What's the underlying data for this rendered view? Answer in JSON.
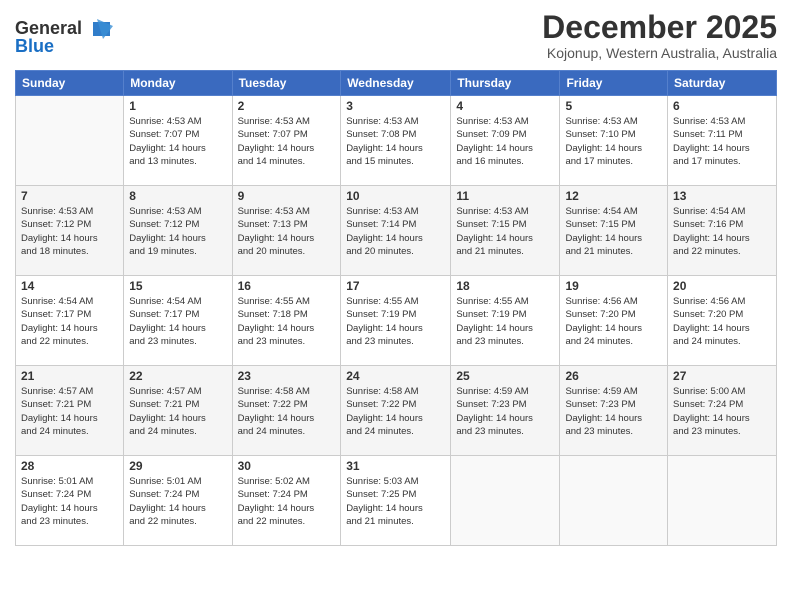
{
  "logo": {
    "line1": "General",
    "line2": "Blue"
  },
  "title": "December 2025",
  "location": "Kojonup, Western Australia, Australia",
  "weekdays": [
    "Sunday",
    "Monday",
    "Tuesday",
    "Wednesday",
    "Thursday",
    "Friday",
    "Saturday"
  ],
  "weeks": [
    [
      {
        "day": "",
        "info": ""
      },
      {
        "day": "1",
        "info": "Sunrise: 4:53 AM\nSunset: 7:07 PM\nDaylight: 14 hours\nand 13 minutes."
      },
      {
        "day": "2",
        "info": "Sunrise: 4:53 AM\nSunset: 7:07 PM\nDaylight: 14 hours\nand 14 minutes."
      },
      {
        "day": "3",
        "info": "Sunrise: 4:53 AM\nSunset: 7:08 PM\nDaylight: 14 hours\nand 15 minutes."
      },
      {
        "day": "4",
        "info": "Sunrise: 4:53 AM\nSunset: 7:09 PM\nDaylight: 14 hours\nand 16 minutes."
      },
      {
        "day": "5",
        "info": "Sunrise: 4:53 AM\nSunset: 7:10 PM\nDaylight: 14 hours\nand 17 minutes."
      },
      {
        "day": "6",
        "info": "Sunrise: 4:53 AM\nSunset: 7:11 PM\nDaylight: 14 hours\nand 17 minutes."
      }
    ],
    [
      {
        "day": "7",
        "info": "Sunrise: 4:53 AM\nSunset: 7:12 PM\nDaylight: 14 hours\nand 18 minutes."
      },
      {
        "day": "8",
        "info": "Sunrise: 4:53 AM\nSunset: 7:12 PM\nDaylight: 14 hours\nand 19 minutes."
      },
      {
        "day": "9",
        "info": "Sunrise: 4:53 AM\nSunset: 7:13 PM\nDaylight: 14 hours\nand 20 minutes."
      },
      {
        "day": "10",
        "info": "Sunrise: 4:53 AM\nSunset: 7:14 PM\nDaylight: 14 hours\nand 20 minutes."
      },
      {
        "day": "11",
        "info": "Sunrise: 4:53 AM\nSunset: 7:15 PM\nDaylight: 14 hours\nand 21 minutes."
      },
      {
        "day": "12",
        "info": "Sunrise: 4:54 AM\nSunset: 7:15 PM\nDaylight: 14 hours\nand 21 minutes."
      },
      {
        "day": "13",
        "info": "Sunrise: 4:54 AM\nSunset: 7:16 PM\nDaylight: 14 hours\nand 22 minutes."
      }
    ],
    [
      {
        "day": "14",
        "info": "Sunrise: 4:54 AM\nSunset: 7:17 PM\nDaylight: 14 hours\nand 22 minutes."
      },
      {
        "day": "15",
        "info": "Sunrise: 4:54 AM\nSunset: 7:17 PM\nDaylight: 14 hours\nand 23 minutes."
      },
      {
        "day": "16",
        "info": "Sunrise: 4:55 AM\nSunset: 7:18 PM\nDaylight: 14 hours\nand 23 minutes."
      },
      {
        "day": "17",
        "info": "Sunrise: 4:55 AM\nSunset: 7:19 PM\nDaylight: 14 hours\nand 23 minutes."
      },
      {
        "day": "18",
        "info": "Sunrise: 4:55 AM\nSunset: 7:19 PM\nDaylight: 14 hours\nand 23 minutes."
      },
      {
        "day": "19",
        "info": "Sunrise: 4:56 AM\nSunset: 7:20 PM\nDaylight: 14 hours\nand 24 minutes."
      },
      {
        "day": "20",
        "info": "Sunrise: 4:56 AM\nSunset: 7:20 PM\nDaylight: 14 hours\nand 24 minutes."
      }
    ],
    [
      {
        "day": "21",
        "info": "Sunrise: 4:57 AM\nSunset: 7:21 PM\nDaylight: 14 hours\nand 24 minutes."
      },
      {
        "day": "22",
        "info": "Sunrise: 4:57 AM\nSunset: 7:21 PM\nDaylight: 14 hours\nand 24 minutes."
      },
      {
        "day": "23",
        "info": "Sunrise: 4:58 AM\nSunset: 7:22 PM\nDaylight: 14 hours\nand 24 minutes."
      },
      {
        "day": "24",
        "info": "Sunrise: 4:58 AM\nSunset: 7:22 PM\nDaylight: 14 hours\nand 24 minutes."
      },
      {
        "day": "25",
        "info": "Sunrise: 4:59 AM\nSunset: 7:23 PM\nDaylight: 14 hours\nand 23 minutes."
      },
      {
        "day": "26",
        "info": "Sunrise: 4:59 AM\nSunset: 7:23 PM\nDaylight: 14 hours\nand 23 minutes."
      },
      {
        "day": "27",
        "info": "Sunrise: 5:00 AM\nSunset: 7:24 PM\nDaylight: 14 hours\nand 23 minutes."
      }
    ],
    [
      {
        "day": "28",
        "info": "Sunrise: 5:01 AM\nSunset: 7:24 PM\nDaylight: 14 hours\nand 23 minutes."
      },
      {
        "day": "29",
        "info": "Sunrise: 5:01 AM\nSunset: 7:24 PM\nDaylight: 14 hours\nand 22 minutes."
      },
      {
        "day": "30",
        "info": "Sunrise: 5:02 AM\nSunset: 7:24 PM\nDaylight: 14 hours\nand 22 minutes."
      },
      {
        "day": "31",
        "info": "Sunrise: 5:03 AM\nSunset: 7:25 PM\nDaylight: 14 hours\nand 21 minutes."
      },
      {
        "day": "",
        "info": ""
      },
      {
        "day": "",
        "info": ""
      },
      {
        "day": "",
        "info": ""
      }
    ]
  ]
}
